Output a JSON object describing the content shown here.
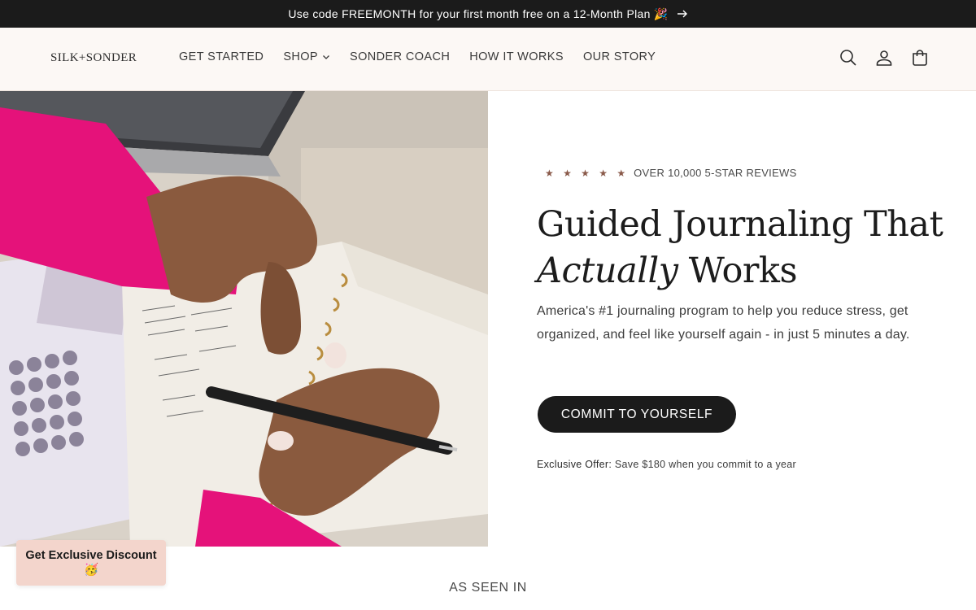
{
  "announcement": {
    "text": "Use code FREEMONTH for your first month free on a 12-Month Plan 🎉",
    "arrow_icon": "arrow-right-icon"
  },
  "header": {
    "logo": "SILK+SONDER",
    "nav": [
      {
        "label": "GET STARTED"
      },
      {
        "label": "SHOP",
        "icon": "chevron-down-icon"
      },
      {
        "label": "SONDER COACH"
      },
      {
        "label": "HOW IT WORKS"
      },
      {
        "label": "OUR STORY"
      }
    ],
    "icons": [
      "search-icon",
      "account-icon",
      "cart-icon"
    ]
  },
  "hero": {
    "stars": "★ ★ ★ ★ ★",
    "reviews": "OVER 10,000 5-STAR REVIEWS",
    "headline_part1": "Guided Journaling That",
    "headline_italic": "Actually",
    "headline_part2": " Works",
    "subcopy": "America's #1 journaling program to help you reduce stress, get organized, and feel like yourself again - in just 5 minutes a day.",
    "cta": "COMMIT TO YOURSELF",
    "offer_label": "Exclusive Offer:",
    "offer_text": " Save $180 when you commit to a year"
  },
  "seen_in": "AS SEEN IN",
  "discount_popup": {
    "text": "Get Exclusive Discount",
    "emoji": "🥳"
  },
  "colors": {
    "announcement_bg": "#1b1b1b",
    "header_bg": "#fcf8f5",
    "cta_bg": "#1b1b1b",
    "star_color": "#8a5a4a",
    "discount_bg": "#f3d5cc"
  }
}
